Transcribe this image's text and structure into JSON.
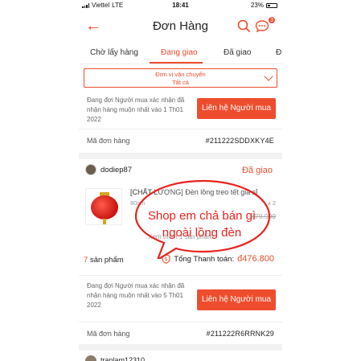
{
  "status_bar": {
    "carrier": "Viettel",
    "network": "LTE",
    "time": "18:41",
    "battery": "23%"
  },
  "header": {
    "title": "Đơn Hàng",
    "chat_badge": "3",
    "icons": [
      "back-arrow-icon",
      "search-icon",
      "chat-icon"
    ]
  },
  "tabs": [
    {
      "label": "Chờ lấy hàng",
      "active": false
    },
    {
      "label": "Đang giao",
      "active": true
    },
    {
      "label": "Đã giao",
      "active": false
    },
    {
      "label": "Đ",
      "active": false
    }
  ],
  "filter": {
    "label": "Đơn vị vận chuyển",
    "value": "Tất cả"
  },
  "orders": [
    {
      "notice": "Đang đợi Người mua xác nhận đã nhận hàng muộn nhất vào 1 Th01 2022",
      "contact_label": "Liên hệ Người mua",
      "code_label": "Mã đơn hàng",
      "code": "#211222SDDXKY4E"
    },
    {
      "shop": "dodiep87",
      "status": "Đã giao",
      "product_name": "[CHẤT LƯỢNG] Đèn lồng treo tết giá sỉ",
      "variant": "80cm",
      "qty": "x 2",
      "price": "đ79.900",
      "more": "Xem thêm 1 sản phẩm",
      "count_num": "7",
      "count_label": "sản phẩm",
      "total_label": "Tổng Thanh toán:",
      "total": "đ476.800",
      "notice": "Đang đợi Người mua xác nhận đã nhận hàng muộn nhất vào 5 Th01 2022",
      "contact_label": "Liên hệ Người mua",
      "code_label": "Mã đơn hàng",
      "code": "#211222R6RRNK29"
    },
    {
      "shop": "tranlam12310"
    }
  ],
  "annotation": {
    "line1": "Shop em chả bán gì",
    "line2": "ngoài lồng đèn"
  },
  "colors": {
    "accent": "#ee4d2d",
    "annotation": "#e8231f",
    "background": "#f2f2f2"
  }
}
